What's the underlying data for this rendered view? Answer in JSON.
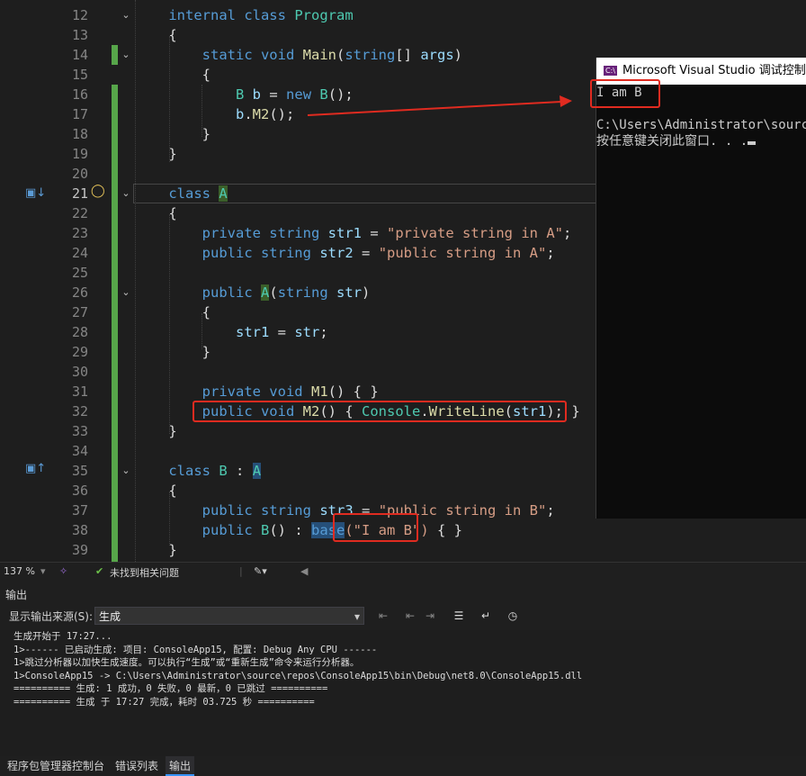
{
  "editor": {
    "line_numbers": [
      "12",
      "13",
      "14",
      "15",
      "16",
      "17",
      "18",
      "19",
      "20",
      "21",
      "22",
      "23",
      "24",
      "25",
      "26",
      "27",
      "28",
      "29",
      "30",
      "31",
      "32",
      "33",
      "34",
      "35",
      "36",
      "37",
      "38",
      "39"
    ],
    "active_line": "21"
  },
  "console": {
    "title": "Microsoft Visual Studio 调试控制台",
    "icon_text": "C:\\",
    "lines": [
      "I am B",
      "",
      "C:\\Users\\Administrator\\source",
      "按任意键关闭此窗口. . ."
    ]
  },
  "statusbar": {
    "zoom": "137 %",
    "issues": "未找到相关问题"
  },
  "output_panel": {
    "title": "输出",
    "source_label": "显示输出来源(S):",
    "source_value": "生成",
    "lines": [
      "生成开始于 17:27...",
      "1>------ 已启动生成: 项目: ConsoleApp15, 配置: Debug Any CPU ------",
      "1>跳过分析器以加快生成速度。可以执行“生成”或“重新生成”命令来运行分析器。",
      "1>ConsoleApp15 -> C:\\Users\\Administrator\\source\\repos\\ConsoleApp15\\bin\\Debug\\net8.0\\ConsoleApp15.dll",
      "========== 生成: 1 成功，0 失败，0 最新，0 已跳过 ==========",
      "========== 生成 于 17:27 完成，耗时 03.725 秒 =========="
    ]
  },
  "bottom_tabs": [
    "程序包管理器控制台",
    "错误列表",
    "输出"
  ],
  "colors": {
    "highlight_box": "#e02b20",
    "change_bar": "#57a64a",
    "selected_tab": "#3794ff"
  }
}
